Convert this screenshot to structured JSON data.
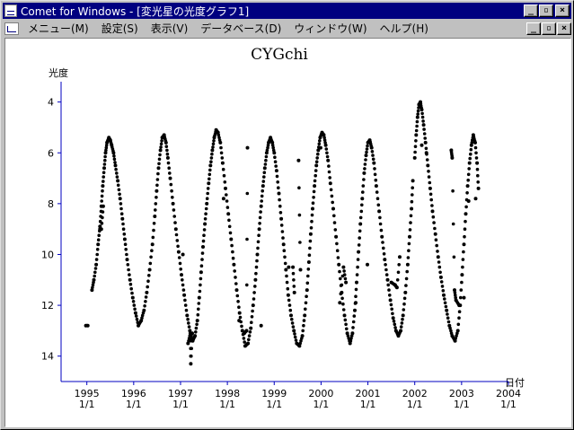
{
  "window": {
    "title": "Comet for Windows - [変光星の光度グラフ1]",
    "minimize_glyph": "_",
    "restore_glyph": "▫",
    "close_glyph": "×"
  },
  "menu": {
    "items": [
      {
        "label": "メニュー(M)"
      },
      {
        "label": "設定(S)"
      },
      {
        "label": "表示(V)"
      },
      {
        "label": "データベース(D)"
      },
      {
        "label": "ウィンドウ(W)"
      },
      {
        "label": "ヘルプ(H)"
      }
    ]
  },
  "chart_data": {
    "type": "scatter",
    "title": "CYGchi",
    "ylabel": "光度",
    "xlabel": "日付",
    "y_inverted": true,
    "ylim": [
      15,
      3.2
    ],
    "xlim": [
      1994.45,
      2004.0
    ],
    "y_ticks": [
      4,
      6,
      8,
      10,
      12,
      14
    ],
    "x_ticks": [
      {
        "year": 1995,
        "label": "1995",
        "sub": "1/1"
      },
      {
        "year": 1996,
        "label": "1996",
        "sub": "1/1"
      },
      {
        "year": 1997,
        "label": "1997",
        "sub": "1/1"
      },
      {
        "year": 1998,
        "label": "1998",
        "sub": "1/1"
      },
      {
        "year": 1999,
        "label": "1999",
        "sub": "1/1"
      },
      {
        "year": 2000,
        "label": "2000",
        "sub": "1/1"
      },
      {
        "year": 2001,
        "label": "2001",
        "sub": "1/1"
      },
      {
        "year": 2002,
        "label": "2002",
        "sub": "1/1"
      },
      {
        "year": 2003,
        "label": "2003",
        "sub": "1/1"
      },
      {
        "year": 2004,
        "label": "2004",
        "sub": "1/1"
      }
    ],
    "series": [
      {
        "color": "#000000",
        "points": [
          [
            1995.11,
            11.4
          ],
          [
            1995.15,
            11.0
          ],
          [
            1995.2,
            10.4
          ],
          [
            1995.24,
            9.6
          ],
          [
            1995.28,
            8.9
          ],
          [
            1995.31,
            8.1
          ],
          [
            1995.34,
            7.3
          ],
          [
            1995.37,
            6.6
          ],
          [
            1995.4,
            6.0
          ],
          [
            1995.43,
            5.6
          ],
          [
            1995.47,
            5.4
          ],
          [
            1995.5,
            5.5
          ],
          [
            1995.53,
            5.7
          ],
          [
            1995.57,
            6.0
          ],
          [
            1995.61,
            6.5
          ],
          [
            1995.66,
            7.1
          ],
          [
            1995.71,
            7.8
          ],
          [
            1995.76,
            8.6
          ],
          [
            1995.81,
            9.4
          ],
          [
            1995.86,
            10.2
          ],
          [
            1995.92,
            11.0
          ],
          [
            1995.98,
            11.7
          ],
          [
            1996.04,
            12.3
          ],
          [
            1996.1,
            12.8
          ],
          [
            1996.16,
            12.6
          ],
          [
            1996.22,
            12.2
          ],
          [
            1996.28,
            11.5
          ],
          [
            1996.34,
            10.6
          ],
          [
            1996.4,
            9.6
          ],
          [
            1996.45,
            8.5
          ],
          [
            1996.49,
            7.5
          ],
          [
            1996.53,
            6.6
          ],
          [
            1996.57,
            5.9
          ],
          [
            1996.61,
            5.4
          ],
          [
            1996.65,
            5.3
          ],
          [
            1996.69,
            5.6
          ],
          [
            1996.73,
            6.2
          ],
          [
            1996.78,
            7.0
          ],
          [
            1996.84,
            8.0
          ],
          [
            1996.9,
            9.0
          ],
          [
            1996.96,
            9.9
          ],
          [
            1997.02,
            10.8
          ],
          [
            1997.08,
            11.6
          ],
          [
            1997.14,
            12.4
          ],
          [
            1997.2,
            13.0
          ],
          [
            1997.26,
            13.4
          ],
          [
            1997.31,
            13.2
          ],
          [
            1997.36,
            12.6
          ],
          [
            1997.4,
            11.7
          ],
          [
            1997.44,
            10.7
          ],
          [
            1997.48,
            9.7
          ],
          [
            1997.52,
            8.8
          ],
          [
            1997.56,
            8.0
          ],
          [
            1997.6,
            7.2
          ],
          [
            1997.64,
            6.5
          ],
          [
            1997.68,
            5.9
          ],
          [
            1997.72,
            5.4
          ],
          [
            1997.76,
            5.1
          ],
          [
            1997.8,
            5.2
          ],
          [
            1997.85,
            5.6
          ],
          [
            1997.9,
            6.4
          ],
          [
            1997.96,
            7.4
          ],
          [
            1998.02,
            8.4
          ],
          [
            1998.08,
            9.4
          ],
          [
            1998.14,
            10.4
          ],
          [
            1998.2,
            11.4
          ],
          [
            1998.26,
            12.3
          ],
          [
            1998.32,
            13.0
          ],
          [
            1998.38,
            13.6
          ],
          [
            1998.44,
            13.5
          ],
          [
            1998.5,
            12.9
          ],
          [
            1998.55,
            12.0
          ],
          [
            1998.6,
            11.0
          ],
          [
            1998.64,
            10.0
          ],
          [
            1998.68,
            9.0
          ],
          [
            1998.72,
            8.1
          ],
          [
            1998.76,
            7.3
          ],
          [
            1998.8,
            6.6
          ],
          [
            1998.84,
            6.0
          ],
          [
            1998.88,
            5.6
          ],
          [
            1998.92,
            5.4
          ],
          [
            1998.96,
            5.6
          ],
          [
            1999.0,
            6.0
          ],
          [
            1999.05,
            6.7
          ],
          [
            1999.1,
            7.6
          ],
          [
            1999.15,
            8.6
          ],
          [
            1999.2,
            9.6
          ],
          [
            1999.25,
            10.6
          ],
          [
            1999.3,
            11.6
          ],
          [
            1999.36,
            12.4
          ],
          [
            1999.42,
            13.0
          ],
          [
            1999.48,
            13.5
          ],
          [
            1999.54,
            13.6
          ],
          [
            1999.6,
            13.2
          ],
          [
            1999.65,
            12.4
          ],
          [
            1999.7,
            11.4
          ],
          [
            1999.74,
            10.3
          ],
          [
            1999.78,
            9.2
          ],
          [
            1999.82,
            8.2
          ],
          [
            1999.86,
            7.3
          ],
          [
            1999.9,
            6.5
          ],
          [
            1999.94,
            5.9
          ],
          [
            1999.98,
            5.4
          ],
          [
            2000.02,
            5.2
          ],
          [
            2000.06,
            5.3
          ],
          [
            2000.1,
            5.7
          ],
          [
            2000.15,
            6.3
          ],
          [
            2000.2,
            7.2
          ],
          [
            2000.26,
            8.2
          ],
          [
            2000.32,
            9.3
          ],
          [
            2000.38,
            10.4
          ],
          [
            2000.44,
            11.5
          ],
          [
            2000.5,
            12.4
          ],
          [
            2000.56,
            13.1
          ],
          [
            2000.62,
            13.5
          ],
          [
            2000.67,
            13.1
          ],
          [
            2000.72,
            12.2
          ],
          [
            2000.76,
            11.1
          ],
          [
            2000.8,
            9.9
          ],
          [
            2000.84,
            8.8
          ],
          [
            2000.88,
            7.8
          ],
          [
            2000.92,
            6.8
          ],
          [
            2000.96,
            6.1
          ],
          [
            2001.0,
            5.6
          ],
          [
            2001.04,
            5.5
          ],
          [
            2001.08,
            5.8
          ],
          [
            2001.13,
            6.4
          ],
          [
            2001.18,
            7.3
          ],
          [
            2001.24,
            8.3
          ],
          [
            2001.3,
            9.3
          ],
          [
            2001.36,
            10.2
          ],
          [
            2001.42,
            11.0
          ],
          [
            2001.48,
            11.8
          ],
          [
            2001.54,
            12.5
          ],
          [
            2001.6,
            13.0
          ],
          [
            2001.65,
            13.2
          ],
          [
            2001.7,
            13.0
          ],
          [
            2001.75,
            12.4
          ],
          [
            2001.8,
            11.5
          ],
          [
            2001.85,
            10.4
          ],
          [
            2001.89,
            9.3
          ],
          [
            2001.93,
            8.2
          ],
          [
            2001.96,
            7.1
          ],
          [
            1999.99,
            5.8
          ],
          [
            2002.0,
            6.2
          ],
          [
            2002.03,
            5.3
          ],
          [
            2002.06,
            4.6
          ],
          [
            2002.09,
            4.1
          ],
          [
            2002.12,
            4.0
          ],
          [
            2002.15,
            4.3
          ],
          [
            2002.19,
            4.9
          ],
          [
            2002.23,
            5.6
          ],
          [
            2002.28,
            6.5
          ],
          [
            2002.33,
            7.4
          ],
          [
            2002.38,
            8.3
          ],
          [
            2002.44,
            9.2
          ],
          [
            2002.5,
            10.1
          ],
          [
            2002.56,
            10.9
          ],
          [
            2002.62,
            11.6
          ],
          [
            2002.68,
            12.2
          ],
          [
            2002.74,
            12.8
          ],
          [
            2002.8,
            13.2
          ],
          [
            2002.86,
            13.4
          ],
          [
            2002.92,
            13.0
          ],
          [
            2002.97,
            12.0
          ],
          [
            2003.01,
            10.8
          ],
          [
            2003.05,
            9.6
          ],
          [
            2003.09,
            8.4
          ],
          [
            2003.13,
            7.3
          ],
          [
            2003.17,
            6.4
          ],
          [
            2003.21,
            5.7
          ],
          [
            2003.25,
            5.3
          ],
          [
            2003.29,
            5.6
          ],
          [
            2003.33,
            6.4
          ],
          [
            2003.36,
            7.4
          ],
          [
            1995.28,
            9.0
          ],
          [
            1995.31,
            9.0
          ],
          [
            1995.35,
            8.1
          ],
          [
            1994.98,
            12.8
          ],
          [
            1995.02,
            12.8
          ],
          [
            1997.05,
            10.0
          ],
          [
            1997.16,
            13.5
          ],
          [
            1997.21,
            13.1
          ],
          [
            1997.22,
            14.3
          ],
          [
            1997.25,
            13.1
          ],
          [
            1997.92,
            7.8
          ],
          [
            1998.25,
            12.6
          ],
          [
            1998.36,
            13.1
          ],
          [
            1998.41,
            13.0
          ],
          [
            1998.43,
            5.8
          ],
          [
            1998.72,
            12.8
          ],
          [
            1999.31,
            10.5
          ],
          [
            1999.4,
            10.5
          ],
          [
            1999.43,
            11.5
          ],
          [
            1999.52,
            6.3
          ],
          [
            1999.56,
            10.6
          ],
          [
            2000.4,
            11.9
          ],
          [
            2000.48,
            10.5
          ],
          [
            2000.53,
            11.1
          ],
          [
            2000.74,
            11.9
          ],
          [
            2000.99,
            10.4
          ],
          [
            2001.5,
            11.1
          ],
          [
            2001.58,
            11.2
          ],
          [
            2001.62,
            11.3
          ],
          [
            2001.68,
            10.1
          ],
          [
            2002.15,
            5.7
          ],
          [
            2002.25,
            6.0
          ],
          [
            2002.78,
            5.9
          ],
          [
            2002.8,
            6.2
          ],
          [
            2002.85,
            11.4
          ],
          [
            2002.88,
            11.8
          ],
          [
            2002.95,
            12.0
          ],
          [
            2003.05,
            11.7
          ],
          [
            2003.15,
            7.9
          ],
          [
            2003.3,
            7.8
          ]
        ]
      }
    ]
  }
}
